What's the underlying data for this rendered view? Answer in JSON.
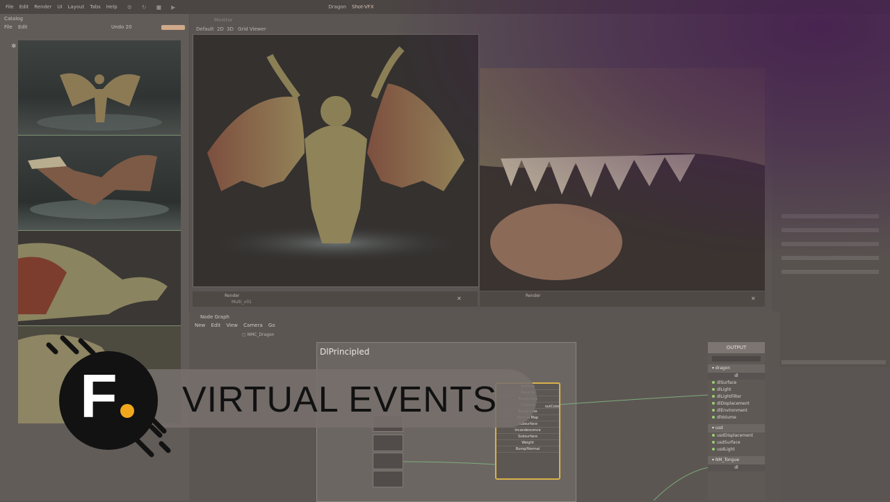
{
  "menubar": {
    "items": [
      "File",
      "Edit",
      "Render",
      "UI",
      "Layout",
      "Tabs",
      "Help"
    ],
    "project": "Dragon",
    "filename": "Shot-VFX"
  },
  "catalog": {
    "title": "Catalog",
    "menu": [
      "File",
      "Edit"
    ],
    "count_label": "Undo 20"
  },
  "viewer": {
    "tabs": [
      "Default",
      "2D",
      "3D",
      "Grid Viewer"
    ],
    "path_label": "Monitor",
    "left_render_label": "Render",
    "left_render_file": "Multi_v01",
    "right_render_label": "Render"
  },
  "node_graph": {
    "header": "Node Graph",
    "menu": [
      "New",
      "Edit",
      "View",
      "Camera",
      "Go"
    ],
    "breadcrumb": "NMC_Dragon",
    "principled_title": "DlPrincipled",
    "shader_rows": [
      "Surface",
      "Material",
      "Roughness",
      "Coating",
      "Roughness",
      "Normal Map",
      "Subsurface",
      "Incandescence",
      "Subsurface",
      "Weight",
      "Bump/Normal"
    ],
    "shader_output": "outColor"
  },
  "output_panel": {
    "title": "OUTPUT",
    "section_dragon": "dragon",
    "dragon_sub": "dl",
    "dragon_ports": [
      "dlSurface",
      "dlLight",
      "dlLightFilter",
      "dlDisplacement",
      "dlEnvironment",
      "dlVolume"
    ],
    "section_usd": "usd",
    "usd_ports": [
      "usdDisplacement",
      "usdSurface",
      "usdLight"
    ],
    "section_tongue": "NM_Tongue",
    "tongue_sub": "dl"
  },
  "banner": {
    "logo_letter": "F",
    "text": "VIRTUAL EVENTS"
  },
  "colors": {
    "accent": "#f2a81d",
    "logo_bg": "#121212",
    "glow": "#46204f",
    "selection": "#d8b24a"
  }
}
